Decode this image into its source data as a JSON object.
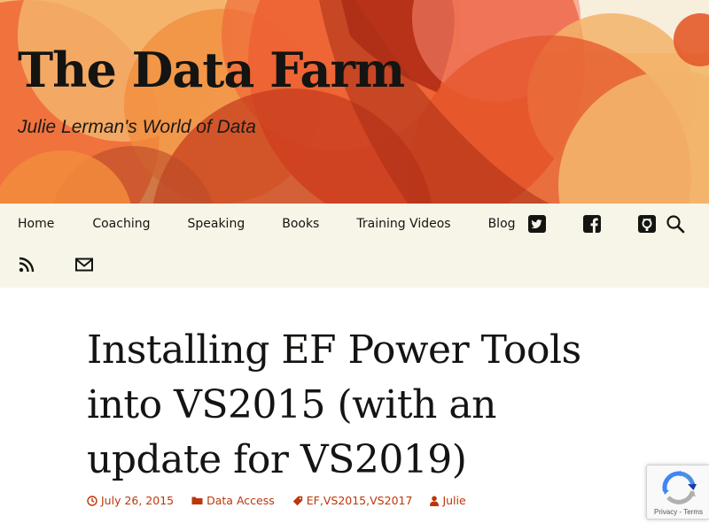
{
  "site": {
    "title": "The Data Farm",
    "tagline": "Julie Lerman's World of Data"
  },
  "nav": {
    "items": [
      {
        "label": "Home"
      },
      {
        "label": "Coaching"
      },
      {
        "label": "Speaking"
      },
      {
        "label": "Books"
      },
      {
        "label": "Training Videos"
      },
      {
        "label": "Blog"
      }
    ],
    "icons": [
      "twitter-icon",
      "facebook-icon",
      "github-icon",
      "search-icon",
      "rss-icon",
      "email-icon"
    ]
  },
  "post": {
    "title": "Installing EF Power Tools into VS2015 (with an update for VS2019)",
    "date": "July 26, 2015",
    "category": "Data Access",
    "tags": [
      "EF",
      "VS2015",
      "VS2017"
    ],
    "tag_separator": ", ",
    "author": "Julie"
  },
  "recaptcha": {
    "privacy": "Privacy",
    "separator": " - ",
    "terms": "Terms"
  },
  "colors": {
    "accent": "#bc360a",
    "nav_bg": "#f7f5e7",
    "text": "#141412"
  }
}
